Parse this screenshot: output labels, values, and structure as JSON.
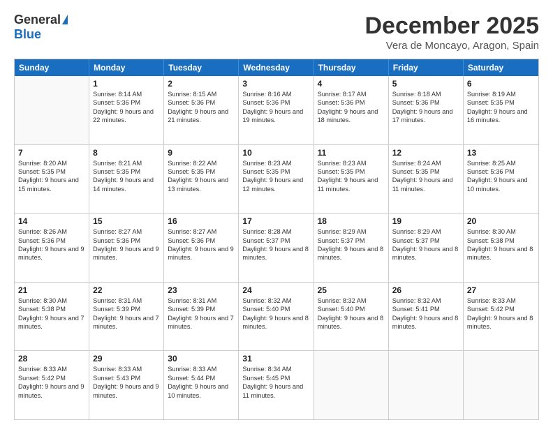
{
  "logo": {
    "general": "General",
    "blue": "Blue"
  },
  "title": "December 2025",
  "location": "Vera de Moncayo, Aragon, Spain",
  "header_days": [
    "Sunday",
    "Monday",
    "Tuesday",
    "Wednesday",
    "Thursday",
    "Friday",
    "Saturday"
  ],
  "weeks": [
    [
      {
        "day": "",
        "empty": true
      },
      {
        "day": "1",
        "sunrise": "8:14 AM",
        "sunset": "5:36 PM",
        "daylight": "9 hours and 22 minutes."
      },
      {
        "day": "2",
        "sunrise": "8:15 AM",
        "sunset": "5:36 PM",
        "daylight": "9 hours and 21 minutes."
      },
      {
        "day": "3",
        "sunrise": "8:16 AM",
        "sunset": "5:36 PM",
        "daylight": "9 hours and 19 minutes."
      },
      {
        "day": "4",
        "sunrise": "8:17 AM",
        "sunset": "5:36 PM",
        "daylight": "9 hours and 18 minutes."
      },
      {
        "day": "5",
        "sunrise": "8:18 AM",
        "sunset": "5:36 PM",
        "daylight": "9 hours and 17 minutes."
      },
      {
        "day": "6",
        "sunrise": "8:19 AM",
        "sunset": "5:35 PM",
        "daylight": "9 hours and 16 minutes."
      }
    ],
    [
      {
        "day": "7",
        "sunrise": "8:20 AM",
        "sunset": "5:35 PM",
        "daylight": "9 hours and 15 minutes."
      },
      {
        "day": "8",
        "sunrise": "8:21 AM",
        "sunset": "5:35 PM",
        "daylight": "9 hours and 14 minutes."
      },
      {
        "day": "9",
        "sunrise": "8:22 AM",
        "sunset": "5:35 PM",
        "daylight": "9 hours and 13 minutes."
      },
      {
        "day": "10",
        "sunrise": "8:23 AM",
        "sunset": "5:35 PM",
        "daylight": "9 hours and 12 minutes."
      },
      {
        "day": "11",
        "sunrise": "8:23 AM",
        "sunset": "5:35 PM",
        "daylight": "9 hours and 11 minutes."
      },
      {
        "day": "12",
        "sunrise": "8:24 AM",
        "sunset": "5:35 PM",
        "daylight": "9 hours and 11 minutes."
      },
      {
        "day": "13",
        "sunrise": "8:25 AM",
        "sunset": "5:36 PM",
        "daylight": "9 hours and 10 minutes."
      }
    ],
    [
      {
        "day": "14",
        "sunrise": "8:26 AM",
        "sunset": "5:36 PM",
        "daylight": "9 hours and 9 minutes."
      },
      {
        "day": "15",
        "sunrise": "8:27 AM",
        "sunset": "5:36 PM",
        "daylight": "9 hours and 9 minutes."
      },
      {
        "day": "16",
        "sunrise": "8:27 AM",
        "sunset": "5:36 PM",
        "daylight": "9 hours and 9 minutes."
      },
      {
        "day": "17",
        "sunrise": "8:28 AM",
        "sunset": "5:37 PM",
        "daylight": "9 hours and 8 minutes."
      },
      {
        "day": "18",
        "sunrise": "8:29 AM",
        "sunset": "5:37 PM",
        "daylight": "9 hours and 8 minutes."
      },
      {
        "day": "19",
        "sunrise": "8:29 AM",
        "sunset": "5:37 PM",
        "daylight": "9 hours and 8 minutes."
      },
      {
        "day": "20",
        "sunrise": "8:30 AM",
        "sunset": "5:38 PM",
        "daylight": "9 hours and 8 minutes."
      }
    ],
    [
      {
        "day": "21",
        "sunrise": "8:30 AM",
        "sunset": "5:38 PM",
        "daylight": "9 hours and 7 minutes."
      },
      {
        "day": "22",
        "sunrise": "8:31 AM",
        "sunset": "5:39 PM",
        "daylight": "9 hours and 7 minutes."
      },
      {
        "day": "23",
        "sunrise": "8:31 AM",
        "sunset": "5:39 PM",
        "daylight": "9 hours and 7 minutes."
      },
      {
        "day": "24",
        "sunrise": "8:32 AM",
        "sunset": "5:40 PM",
        "daylight": "9 hours and 8 minutes."
      },
      {
        "day": "25",
        "sunrise": "8:32 AM",
        "sunset": "5:40 PM",
        "daylight": "9 hours and 8 minutes."
      },
      {
        "day": "26",
        "sunrise": "8:32 AM",
        "sunset": "5:41 PM",
        "daylight": "9 hours and 8 minutes."
      },
      {
        "day": "27",
        "sunrise": "8:33 AM",
        "sunset": "5:42 PM",
        "daylight": "9 hours and 8 minutes."
      }
    ],
    [
      {
        "day": "28",
        "sunrise": "8:33 AM",
        "sunset": "5:42 PM",
        "daylight": "9 hours and 9 minutes."
      },
      {
        "day": "29",
        "sunrise": "8:33 AM",
        "sunset": "5:43 PM",
        "daylight": "9 hours and 9 minutes."
      },
      {
        "day": "30",
        "sunrise": "8:33 AM",
        "sunset": "5:44 PM",
        "daylight": "9 hours and 10 minutes."
      },
      {
        "day": "31",
        "sunrise": "8:34 AM",
        "sunset": "5:45 PM",
        "daylight": "9 hours and 11 minutes."
      },
      {
        "day": "",
        "empty": true
      },
      {
        "day": "",
        "empty": true
      },
      {
        "day": "",
        "empty": true
      }
    ]
  ]
}
